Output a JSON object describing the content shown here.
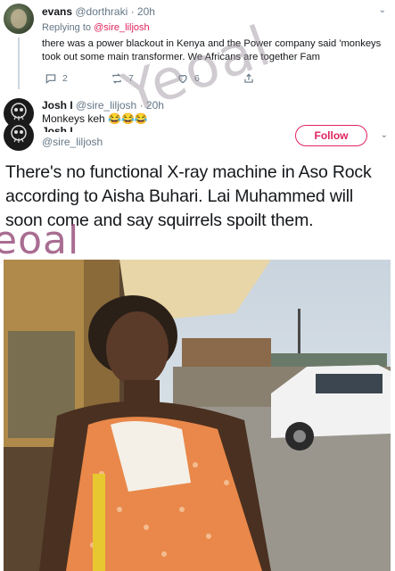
{
  "tweet1": {
    "name": "evans",
    "handle": "@dorthraki",
    "time": "· 20h",
    "reply_prefix": "Replying to",
    "reply_to": "@sire_liljosh",
    "text": "there was a power blackout in Kenya and the Power company said 'monkeys took out some main transformer. We Africans are together Fam",
    "reply_count": "2",
    "retweet_count": "7",
    "like_count": "6"
  },
  "tweet2": {
    "name": "Josh I",
    "handle": "@sire_liljosh",
    "time": "· 20h",
    "text": "Monkeys keh 😂😂😂"
  },
  "tweet3": {
    "name": "Josh I",
    "handle": "@sire_liljosh",
    "follow_label": "Follow",
    "text": "There's no functional X-ray machine in Aso Rock according to Aisha Buhari. Lai Muhammed will soon come and say squirrels spoilt them."
  },
  "watermarks": {
    "main": "Yeoal",
    "side": "eoal"
  },
  "colors": {
    "accent": "#e0245e",
    "muted": "#657786",
    "text": "#14171a"
  }
}
